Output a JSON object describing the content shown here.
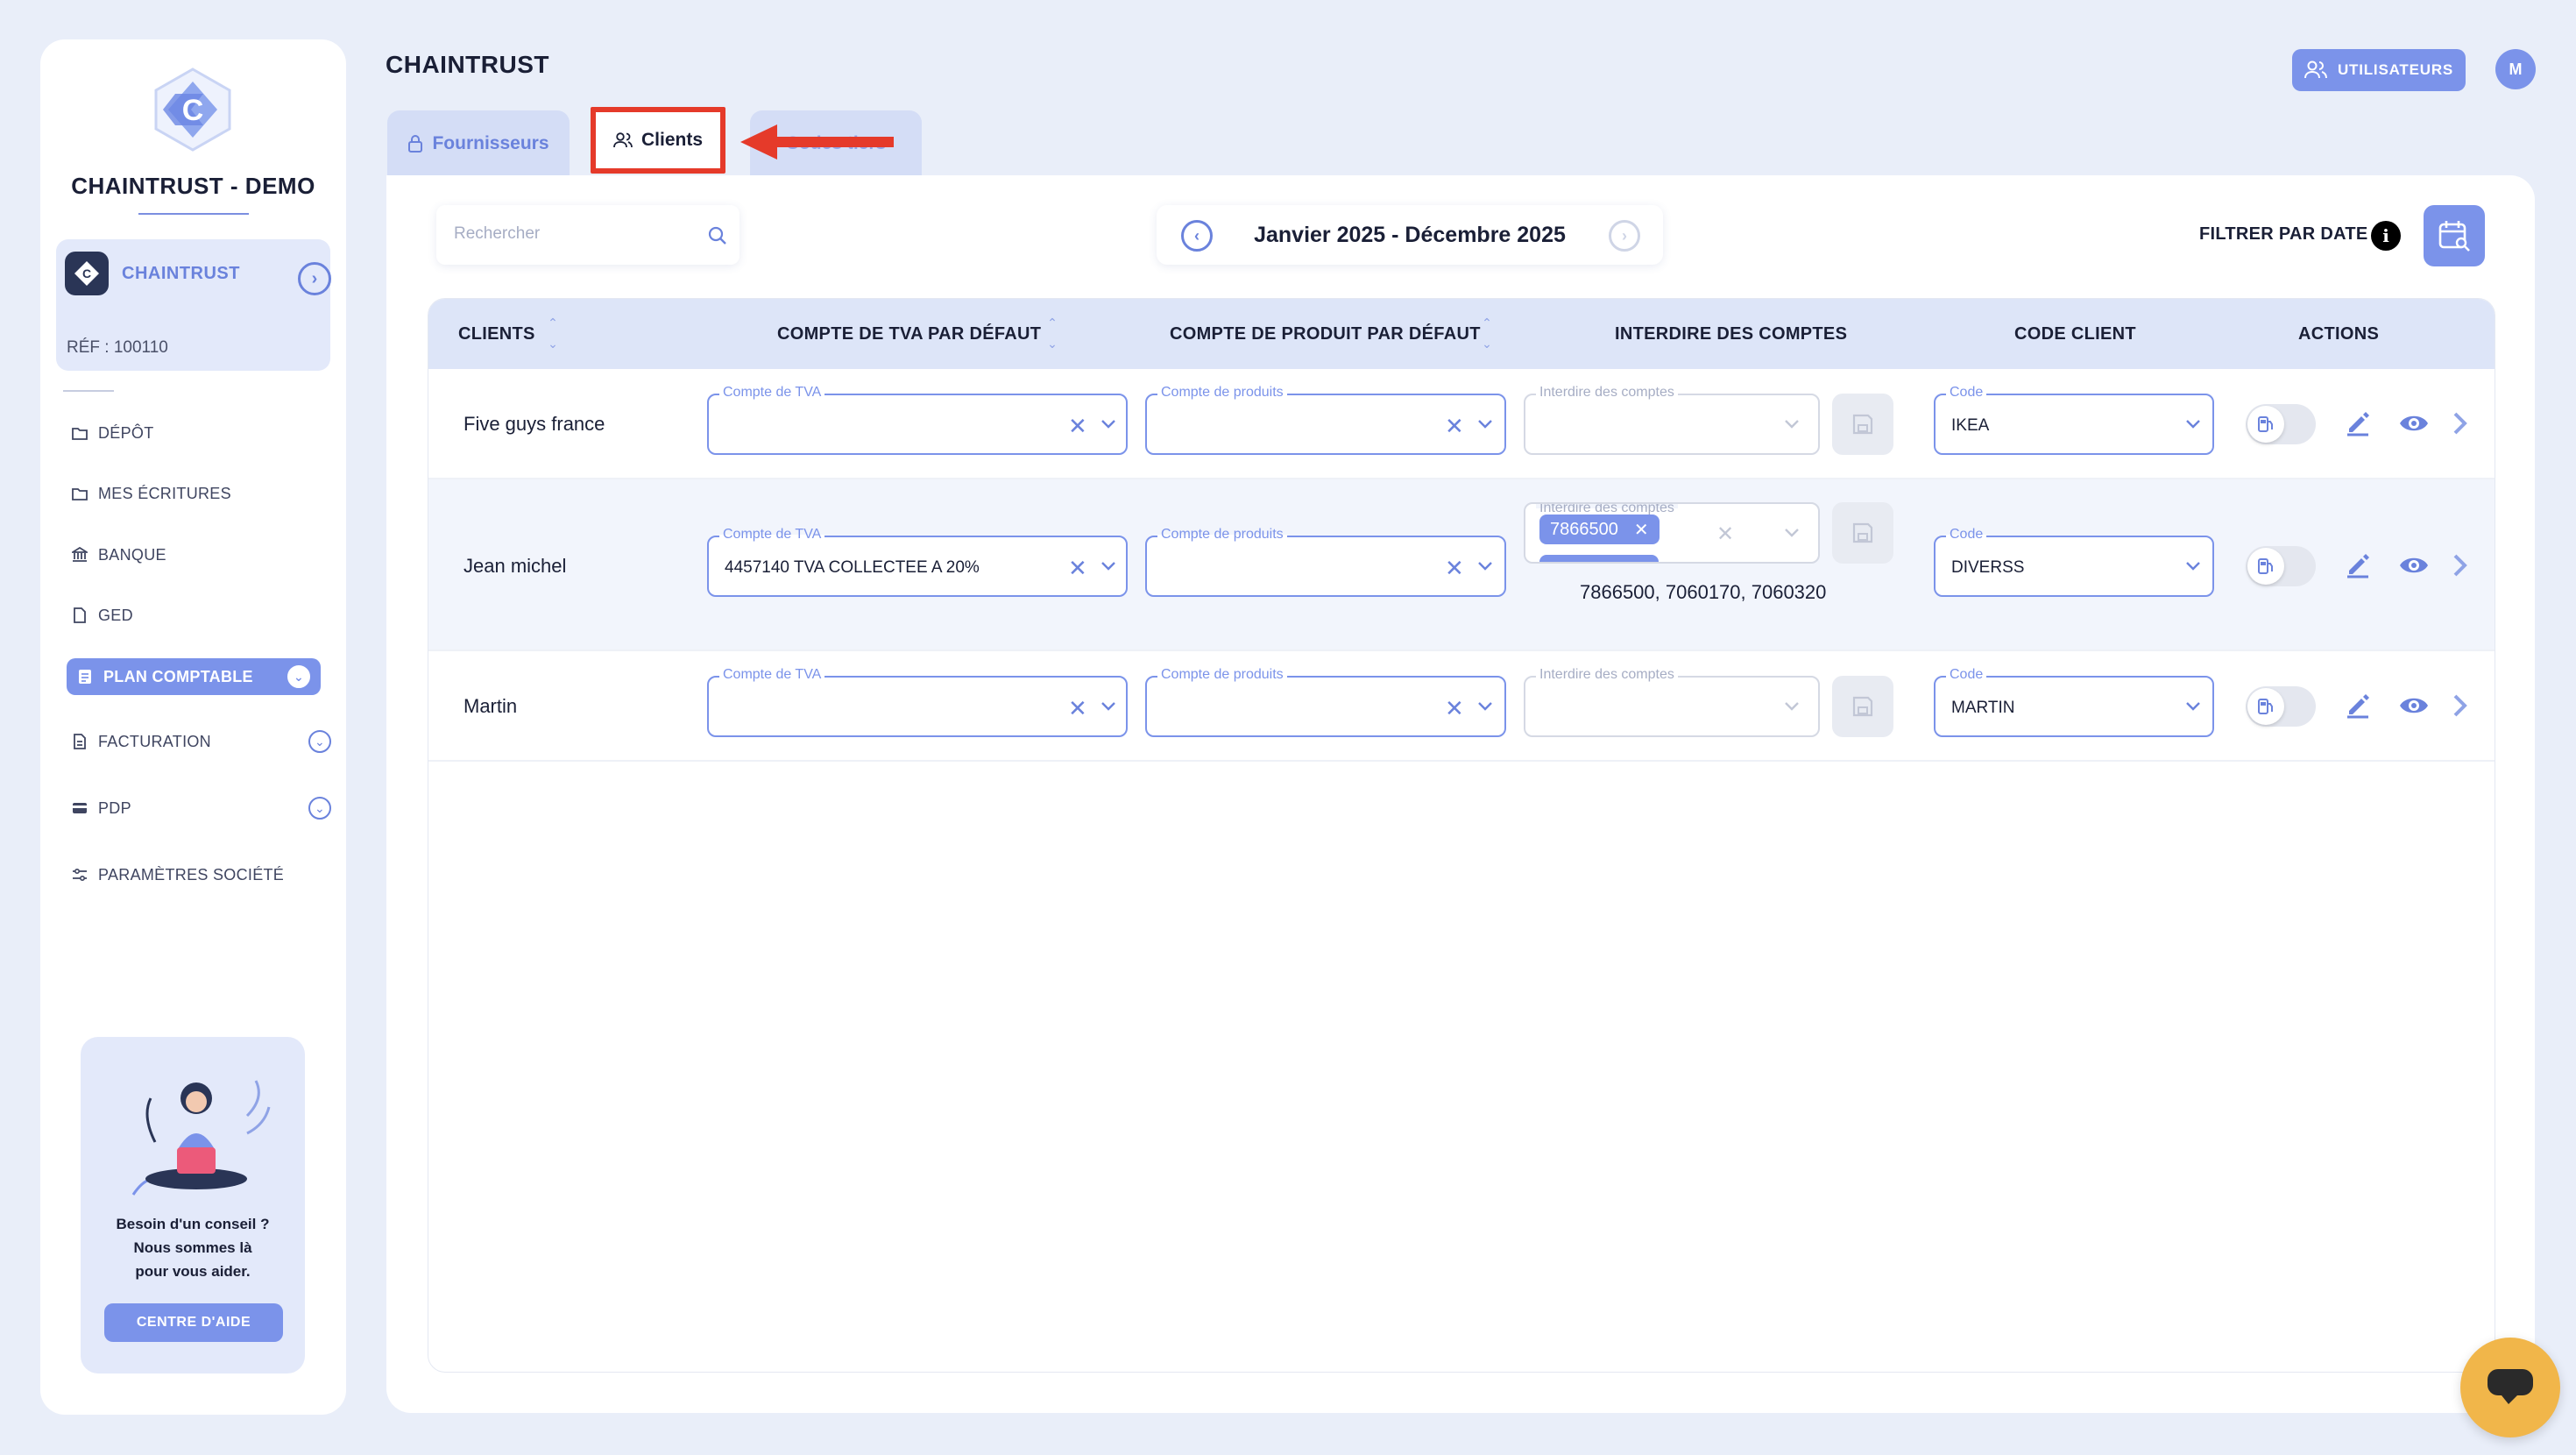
{
  "sidebar": {
    "brand": "CHAINTRUST - DEMO",
    "company": {
      "name": "CHAINTRUST",
      "ref": "RÉF : 100110"
    },
    "nav": [
      {
        "label": "DÉPÔT",
        "icon": "folder-icon"
      },
      {
        "label": "MES ÉCRITURES",
        "icon": "folder-icon"
      },
      {
        "label": "BANQUE",
        "icon": "bank-icon"
      },
      {
        "label": "GED",
        "icon": "document-icon"
      },
      {
        "label": "PLAN COMPTABLE",
        "icon": "ledger-icon",
        "active": true
      },
      {
        "label": "FACTURATION",
        "icon": "invoice-icon"
      },
      {
        "label": "PDP",
        "icon": "card-icon"
      },
      {
        "label": "PARAMÈTRES SOCIÉTÉ",
        "icon": "sliders-icon"
      }
    ],
    "help": {
      "line1": "Besoin d'un conseil ?",
      "line2": "Nous sommes là",
      "line3": "pour vous aider.",
      "button": "CENTRE D'AIDE"
    }
  },
  "header": {
    "title": "CHAINTRUST",
    "users_button": "UTILISATEURS",
    "avatar_initial": "M"
  },
  "tabs": [
    {
      "label": "Fournisseurs"
    },
    {
      "label": "Clients",
      "active": true
    },
    {
      "label": "Codes tiers"
    }
  ],
  "toolbar": {
    "search_placeholder": "Rechercher",
    "period": "Janvier 2025 - Décembre 2025",
    "filter_label": "FILTRER PAR DATE",
    "info": "i"
  },
  "table": {
    "columns": [
      "CLIENTS",
      "COMPTE DE TVA PAR DÉFAUT",
      "COMPTE DE PRODUIT PAR DÉFAUT",
      "INTERDIRE DES COMPTES",
      "CODE CLIENT",
      "ACTIONS"
    ],
    "field_labels": {
      "tva": "Compte de TVA",
      "produit": "Compte de produits",
      "interdire": "Interdire des comptes",
      "code": "Code"
    },
    "rows": [
      {
        "client": "Five guys france",
        "tva": "",
        "produit": "",
        "interdire_chip": "",
        "interdire_summary": "",
        "code": "IKEA"
      },
      {
        "client": "Jean michel",
        "tva": "4457140 TVA COLLECTEE A 20%",
        "produit": "",
        "interdire_chip": "7866500",
        "interdire_summary": "7866500, 7060170, 7060320",
        "code": "DIVERSS"
      },
      {
        "client": "Martin",
        "tva": "",
        "produit": "",
        "interdire_chip": "",
        "interdire_summary": "",
        "code": "MARTIN"
      }
    ]
  },
  "colors": {
    "accent": "#7b93ea",
    "accent_dark": "#6a82dc",
    "highlight": "#e53a2a",
    "chat": "#f1b64a",
    "background": "#e9eef9"
  }
}
